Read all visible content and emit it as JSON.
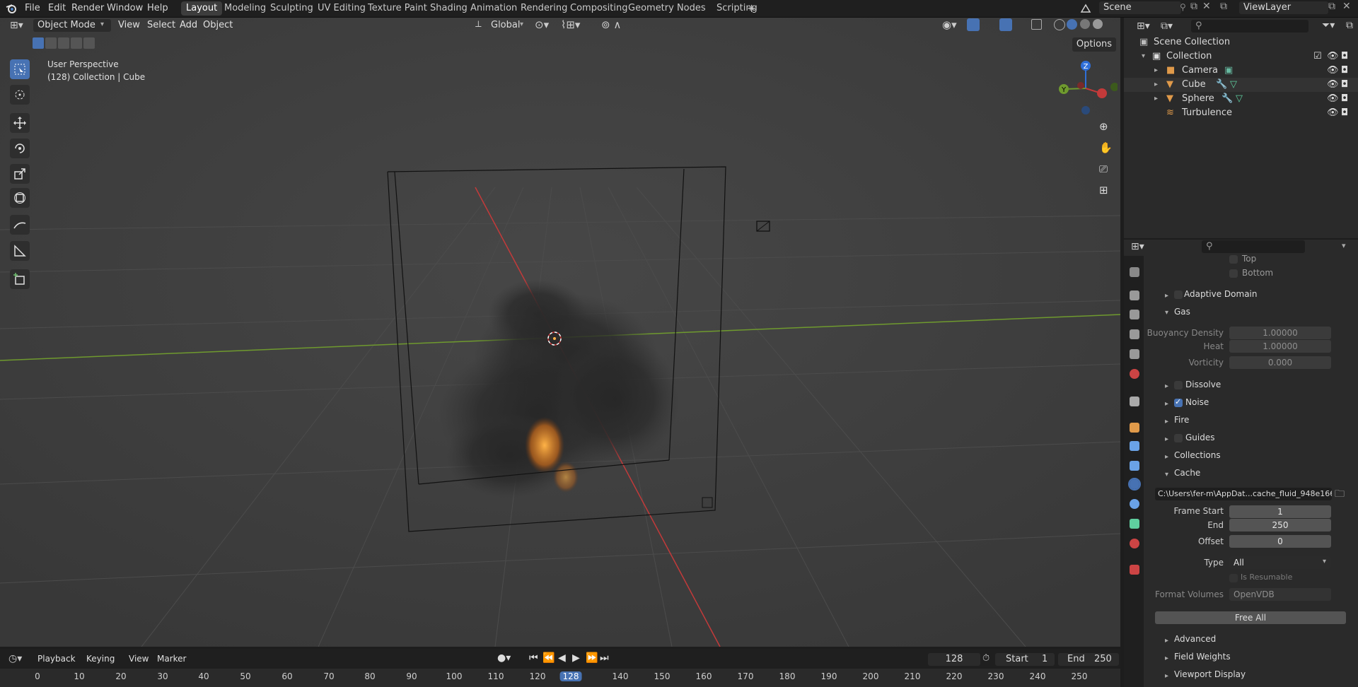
{
  "topbar": {
    "menus": [
      "File",
      "Edit",
      "Render",
      "Window",
      "Help"
    ],
    "workspaces": [
      "Layout",
      "Modeling",
      "Sculpting",
      "UV Editing",
      "Texture Paint",
      "Shading",
      "Animation",
      "Rendering",
      "Compositing",
      "Geometry Nodes",
      "Scripting"
    ],
    "active_workspace": "Layout",
    "add_tab": "+",
    "scene": "Scene",
    "view_layer": "ViewLayer"
  },
  "viewport": {
    "mode": "Object Mode",
    "menus": [
      "View",
      "Select",
      "Add",
      "Object"
    ],
    "transform_orientation": "Global",
    "options_label": "Options",
    "overlay_title": "User Perspective",
    "overlay_subtitle": "(128) Collection | Cube",
    "gizmo_axes": {
      "x": "X",
      "y": "Y",
      "z": "Z"
    },
    "colors": {
      "x_axis": "#c33a3a",
      "y_axis": "#6f9a2e",
      "z_axis": "#2f6fd8",
      "active": "#4772b3"
    }
  },
  "outliner": {
    "root": "Scene Collection",
    "collection": "Collection",
    "objects": [
      "Camera",
      "Cube",
      "Sphere",
      "Turbulence"
    ]
  },
  "properties": {
    "top_items": [
      "Top",
      "Bottom"
    ],
    "adaptive_domain": "Adaptive Domain",
    "gas": {
      "title": "Gas",
      "buoyancy_label": "Buoyancy Density",
      "buoyancy": "1.00000",
      "heat_label": "Heat",
      "heat": "1.00000",
      "vorticity_label": "Vorticity",
      "vorticity": "0.000"
    },
    "dissolve": "Dissolve",
    "noise": "Noise",
    "fire": "Fire",
    "guides": "Guides",
    "collections": "Collections",
    "cache": {
      "title": "Cache",
      "path": "C:\\Users\\fer-m\\AppDat...cache_fluid_948e1664",
      "frame_start_label": "Frame Start",
      "frame_start": "1",
      "end_label": "End",
      "end": "250",
      "offset_label": "Offset",
      "offset": "0",
      "type_label": "Type",
      "type": "All",
      "resumable": "Is Resumable",
      "format_label": "Format Volumes",
      "format": "OpenVDB",
      "free_all": "Free All"
    },
    "advanced": "Advanced",
    "field_weights": "Field Weights",
    "viewport_display": "Viewport Display"
  },
  "timeline": {
    "menus": [
      "Playback",
      "Keying",
      "View",
      "Marker"
    ],
    "current_frame": "128",
    "start_label": "Start",
    "start": "1",
    "end_label": "End",
    "end": "250",
    "ruler": [
      "0",
      "10",
      "20",
      "30",
      "40",
      "50",
      "60",
      "70",
      "80",
      "90",
      "100",
      "110",
      "120",
      "128",
      "140",
      "150",
      "160",
      "170",
      "180",
      "190",
      "200",
      "210",
      "220",
      "230",
      "240",
      "250"
    ]
  }
}
